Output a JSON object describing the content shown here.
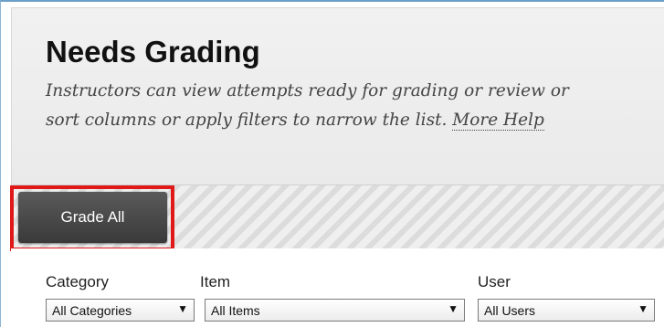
{
  "page": {
    "title": "Needs Grading",
    "description": "Instructors can view attempts ready for grading or review or sort columns or apply filters to narrow the list.",
    "description_line1": "Instructors can view attempts ready for grading or review or",
    "description_line2": "sort columns or apply filters to narrow the list.",
    "more_help": "More Help"
  },
  "actions": {
    "grade_all": "Grade All",
    "highlight_color": "#e01818"
  },
  "filters": {
    "category": {
      "label": "Category",
      "selected": "All Categories"
    },
    "item": {
      "label": "Item",
      "selected": "All Items"
    },
    "user": {
      "label": "User",
      "selected": "All Users"
    }
  },
  "icons": {
    "dropdown": "caret-down-icon"
  }
}
